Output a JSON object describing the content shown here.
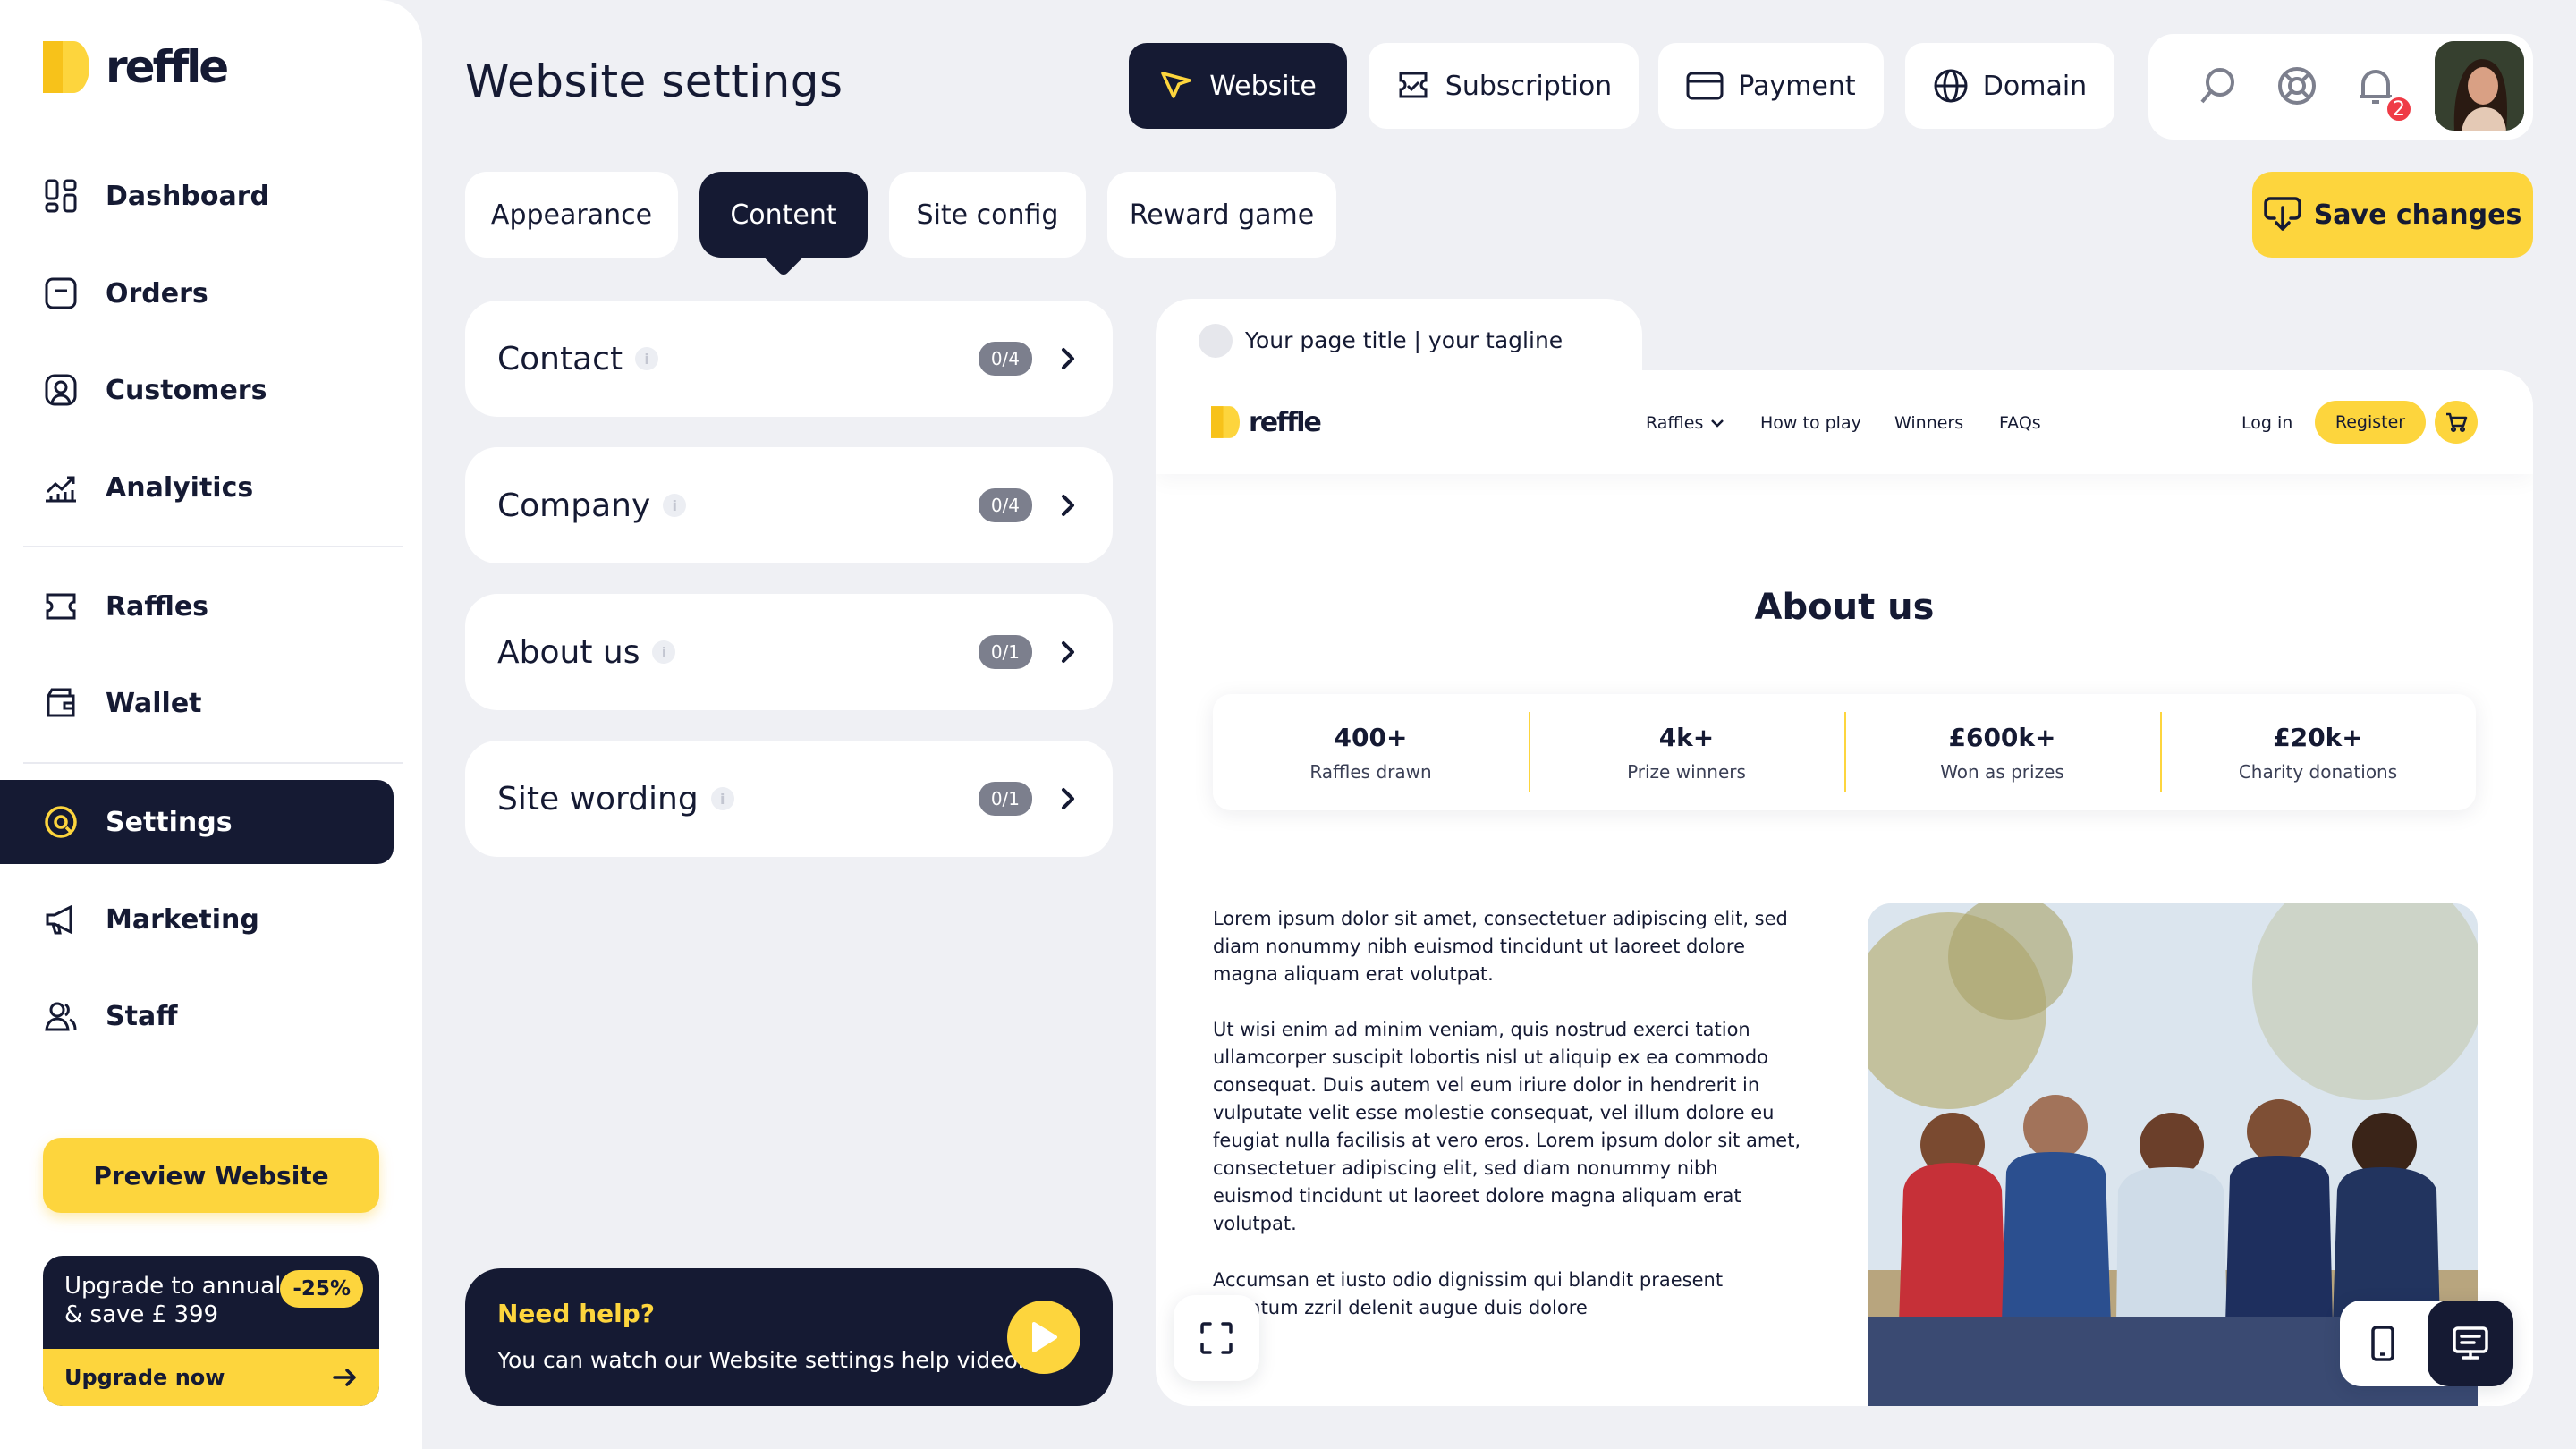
{
  "brand": {
    "name": "reffle",
    "accent": "#fdd53d",
    "dark": "#151a33"
  },
  "sidebar": {
    "items": [
      {
        "label": "Dashboard",
        "icon": "dashboard-icon"
      },
      {
        "label": "Orders",
        "icon": "orders-icon"
      },
      {
        "label": "Customers",
        "icon": "customers-icon"
      },
      {
        "label": "Analyitics",
        "icon": "analytics-icon"
      },
      {
        "label": "Raffles",
        "icon": "ticket-icon"
      },
      {
        "label": "Wallet",
        "icon": "wallet-icon"
      },
      {
        "label": "Settings",
        "icon": "settings-icon",
        "active": true
      },
      {
        "label": "Marketing",
        "icon": "megaphone-icon"
      },
      {
        "label": "Staff",
        "icon": "staff-icon"
      }
    ],
    "preview_label": "Preview Website",
    "upgrade": {
      "line1": "Upgrade to annual",
      "line2": "& save £ 399",
      "badge": "-25%",
      "cta": "Upgrade now"
    }
  },
  "header": {
    "title": "Website settings",
    "tabs": [
      {
        "label": "Website",
        "icon": "cursor-icon",
        "active": true
      },
      {
        "label": "Subscription",
        "icon": "subscription-icon"
      },
      {
        "label": "Payment",
        "icon": "card-icon"
      },
      {
        "label": "Domain",
        "icon": "globe-icon"
      }
    ],
    "notification_count": "2"
  },
  "subtabs": [
    {
      "label": "Appearance"
    },
    {
      "label": "Content",
      "active": true
    },
    {
      "label": "Site config"
    },
    {
      "label": "Reward game"
    }
  ],
  "save_label": "Save changes",
  "sections": [
    {
      "label": "Contact",
      "count": "0/4"
    },
    {
      "label": "Company",
      "count": "0/4"
    },
    {
      "label": "About us",
      "count": "0/1"
    },
    {
      "label": "Site wording",
      "count": "0/1"
    }
  ],
  "help": {
    "title": "Need help?",
    "text": "You can watch our Website settings help video."
  },
  "preview": {
    "tab_title": "Your page title | your tagline",
    "logo": "reffle",
    "nav": [
      "Raffles",
      "How to play",
      "Winners",
      "FAQs"
    ],
    "login": "Log in",
    "register": "Register",
    "about_title": "About us",
    "stats": [
      {
        "value": "400+",
        "label": "Raffles drawn"
      },
      {
        "value": "4k+",
        "label": "Prize winners"
      },
      {
        "value": "£600k+",
        "label": "Won as prizes"
      },
      {
        "value": "£20k+",
        "label": "Charity donations"
      }
    ],
    "paragraphs": [
      "Lorem ipsum dolor sit amet, consectetuer adipiscing elit, sed diam nonummy nibh euismod tincidunt ut laoreet dolore magna aliquam erat volutpat.",
      "Ut wisi enim ad minim veniam, quis nostrud exerci tation ullamcorper suscipit lobortis nisl ut aliquip ex ea commodo consequat. Duis autem vel eum iriure dolor in hendrerit in vulputate velit esse molestie consequat, vel illum dolore eu feugiat nulla facilisis at vero eros. Lorem ipsum dolor sit amet, consectetuer adipiscing elit, sed diam nonummy nibh euismod tincidunt ut laoreet dolore magna aliquam erat volutpat.",
      "Accumsan et iusto odio dignissim qui blandit praesent luptatum zzril delenit augue duis dolore"
    ]
  }
}
